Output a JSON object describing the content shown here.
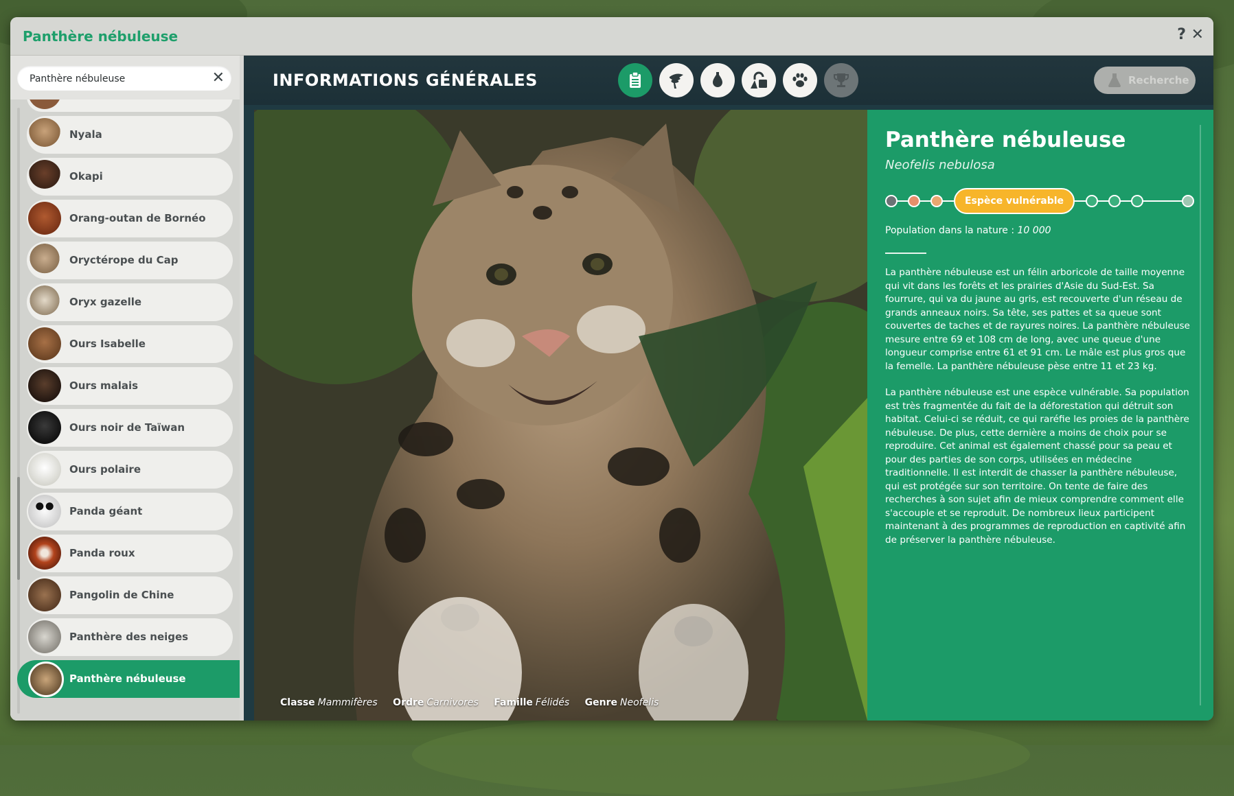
{
  "window": {
    "title": "Panthère nébuleuse",
    "help_label": "?",
    "close_label": "✕"
  },
  "search": {
    "value": "Panthère nébuleuse",
    "clear_label": "✕"
  },
  "species_list": [
    {
      "label": "Nyala",
      "icon": "nyala-icon"
    },
    {
      "label": "Okapi",
      "icon": "okapi-icon"
    },
    {
      "label": "Orang-outan de Bornéo",
      "icon": "orangutan-icon"
    },
    {
      "label": "Oryctérope du Cap",
      "icon": "aardvark-icon"
    },
    {
      "label": "Oryx gazelle",
      "icon": "oryx-icon"
    },
    {
      "label": "Ours Isabelle",
      "icon": "bear-icon"
    },
    {
      "label": "Ours malais",
      "icon": "sun-bear-icon"
    },
    {
      "label": "Ours noir de Taïwan",
      "icon": "black-bear-icon"
    },
    {
      "label": "Ours polaire",
      "icon": "polar-bear-icon"
    },
    {
      "label": "Panda géant",
      "icon": "panda-icon"
    },
    {
      "label": "Panda roux",
      "icon": "red-panda-icon"
    },
    {
      "label": "Pangolin de Chine",
      "icon": "pangolin-icon"
    },
    {
      "label": "Panthère des neiges",
      "icon": "snow-leopard-icon"
    },
    {
      "label": "Panthère nébuleuse",
      "icon": "clouded-leopard-icon",
      "selected": true
    }
  ],
  "header": {
    "title": "INFORMATIONS GÉNÉRALES",
    "tabs": [
      {
        "name": "general-info",
        "icon": "clipboard-icon",
        "state": "active"
      },
      {
        "name": "habitat",
        "icon": "tree-icon",
        "state": "normal"
      },
      {
        "name": "biome",
        "icon": "water-drop-icon",
        "state": "normal"
      },
      {
        "name": "enrichment",
        "icon": "lock-icon",
        "state": "normal"
      },
      {
        "name": "behaviour",
        "icon": "paw-icon",
        "state": "normal"
      },
      {
        "name": "achievements",
        "icon": "trophy-icon",
        "state": "disabled"
      }
    ],
    "research_label": "Recherche"
  },
  "taxonomy": {
    "classe_label": "Classe",
    "classe": "Mammifères",
    "ordre_label": "Ordre",
    "ordre": "Carnivores",
    "famille_label": "Famille",
    "famille": "Félidés",
    "genre_label": "Genre",
    "genre": "Neofelis"
  },
  "info": {
    "name": "Panthère nébuleuse",
    "latin": "Neofelis nebulosa",
    "status": "Espèce vulnérable",
    "population_label": "Population dans la nature :",
    "population_value": "10 000",
    "description": [
      "La panthère nébuleuse est un félin arboricole de taille moyenne qui vit dans les forêts et les prairies d'Asie du Sud-Est. Sa fourrure, qui va du jaune au gris, est recouverte d'un réseau de grands anneaux noirs. Sa tête, ses pattes et sa queue sont couvertes de taches et de rayures noires. La panthère nébuleuse mesure entre 69 et 108 cm de long, avec une queue d'une longueur comprise entre 61 et 91 cm. Le mâle est plus gros que la femelle. La panthère nébuleuse pèse entre 11 et 23 kg.",
      "La panthère nébuleuse est une espèce vulnérable. Sa population est très fragmentée du fait de la déforestation qui détruit son habitat. Celui-ci se réduit, ce qui raréfie les proies de la panthère nébuleuse. De plus, cette dernière a moins de choix pour se reproduire. Cet animal est également chassé pour sa peau et pour des parties de son corps, utilisées en médecine traditionnelle. Il est interdit de chasser la panthère nébuleuse, qui est protégée sur son territoire. On tente de faire des recherches à son sujet afin de mieux comprendre comment elle s'accouple et se reproduit. De nombreux lieux participent maintenant à des programmes de reproduction en captivité afin de préserver la panthère nébuleuse."
    ]
  },
  "colors": {
    "accent_green": "#1c9b68",
    "status_orange": "#f7b52a",
    "header_dark": "#1f3a42"
  }
}
